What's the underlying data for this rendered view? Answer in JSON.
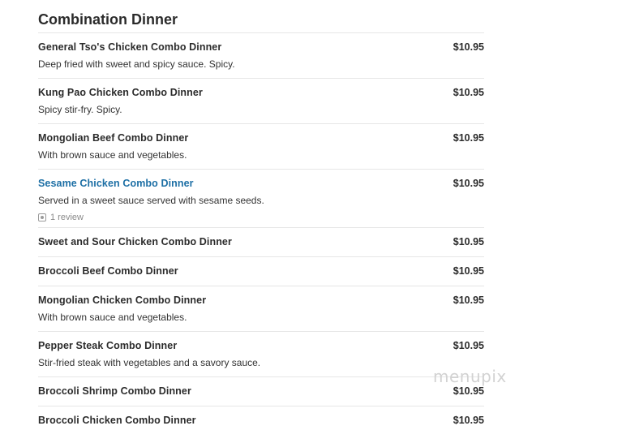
{
  "section": {
    "title": "Combination Dinner"
  },
  "items": [
    {
      "name": "General Tso's Chicken Combo Dinner",
      "price": "$10.95",
      "description": "Deep fried with sweet and spicy sauce. Spicy."
    },
    {
      "name": "Kung Pao Chicken Combo Dinner",
      "price": "$10.95",
      "description": "Spicy stir-fry. Spicy."
    },
    {
      "name": "Mongolian Beef Combo Dinner",
      "price": "$10.95",
      "description": "With brown sauce and vegetables."
    },
    {
      "name": "Sesame Chicken Combo Dinner",
      "price": "$10.95",
      "description": "Served in a sweet sauce served with sesame seeds.",
      "review": "1 review"
    },
    {
      "name": "Sweet and Sour Chicken Combo Dinner",
      "price": "$10.95"
    },
    {
      "name": "Broccoli Beef Combo Dinner",
      "price": "$10.95"
    },
    {
      "name": "Mongolian Chicken Combo Dinner",
      "price": "$10.95",
      "description": "With brown sauce and vegetables."
    },
    {
      "name": "Pepper Steak Combo Dinner",
      "price": "$10.95",
      "description": "Stir-fried steak with vegetables and a savory sauce."
    },
    {
      "name": "Broccoli Shrimp Combo Dinner",
      "price": "$10.95"
    },
    {
      "name": "Broccoli Chicken Combo Dinner",
      "price": "$10.95"
    }
  ],
  "watermark": "menupix",
  "colors": {
    "link": "#1d6fa5",
    "text": "#2b2b2b",
    "divider": "#e6e6e6"
  }
}
